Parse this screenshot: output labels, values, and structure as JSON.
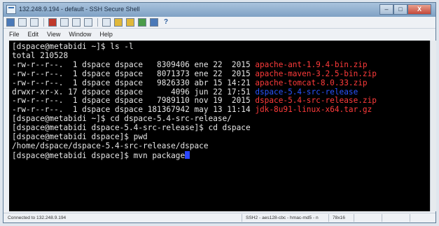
{
  "window": {
    "title": "132.248.9.194 - default - SSH Secure Shell",
    "minimize": "–",
    "maximize": "□",
    "close": "X"
  },
  "menu": {
    "items": [
      "File",
      "Edit",
      "View",
      "Window",
      "Help"
    ]
  },
  "terminal": {
    "lines": [
      {
        "text": "[dspace@metabidi ~]$ ls -l"
      },
      {
        "text": "total 210528"
      },
      {
        "text": "-rw-r--r--.  1 dspace dspace   8309406 ene 22  2015 ",
        "file": "apache-ant-1.9.4-bin.zip",
        "file_color": "red"
      },
      {
        "text": "-rw-r--r--.  1 dspace dspace   8071373 ene 22  2015 ",
        "file": "apache-maven-3.2.5-bin.zip",
        "file_color": "red"
      },
      {
        "text": "-rw-r--r--.  1 dspace dspace   9826330 abr 15 14:21 ",
        "file": "apache-tomcat-8.0.33.zip",
        "file_color": "red"
      },
      {
        "text": "drwxr-xr-x. 17 dspace dspace      4096 jun 22 17:51 ",
        "file": "dspace-5.4-src-release",
        "file_color": "blue"
      },
      {
        "text": "-rw-r--r--.  1 dspace dspace   7989110 nov 19  2015 ",
        "file": "dspace-5.4-src-release.zip",
        "file_color": "red"
      },
      {
        "text": "-rw-r--r--.  1 dspace dspace 181367942 may 13 11:14 ",
        "file": "jdk-8u91-linux-x64.tar.gz",
        "file_color": "red"
      },
      {
        "text": "[dspace@metabidi ~]$ cd dspace-5.4-src-release/"
      },
      {
        "text": "[dspace@metabidi dspace-5.4-src-release]$ cd dspace"
      },
      {
        "text": "[dspace@metabidi dspace]$ pwd"
      },
      {
        "text": "/home/dspace/dspace-5.4-src-release/dspace"
      },
      {
        "text": "[dspace@metabidi dspace]$ mvn package",
        "cursor": true
      }
    ]
  },
  "status": {
    "connection": "Connected to 132.248.9.194",
    "cipher": "SSH2 - aes128-cbc - hmac-md5 - n",
    "size": "78x16"
  },
  "colors": {
    "terminal_bg": "#000000",
    "terminal_fg": "#e6e6e6",
    "file_red": "#ff3b3b",
    "file_blue": "#2a55ff",
    "cursor": "#2a46ff"
  }
}
